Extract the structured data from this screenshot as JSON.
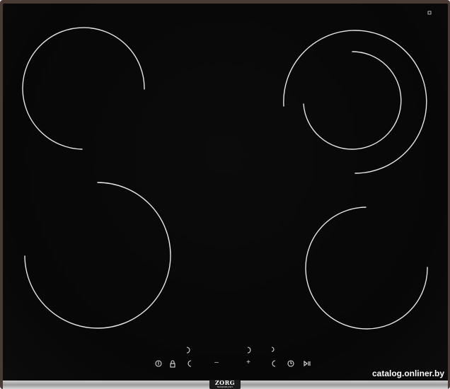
{
  "brand": {
    "name": "ZORG",
    "tagline": "TECHNOLOGY"
  },
  "watermark": {
    "text": "catalog.onliner.by"
  },
  "controls": {
    "plus_label": "+",
    "minus_label": "–"
  },
  "colors": {
    "glass": "#080808",
    "frame": "#4a3a36",
    "trim": "#b5b5b5",
    "zone_line": "#e8e8e8"
  }
}
